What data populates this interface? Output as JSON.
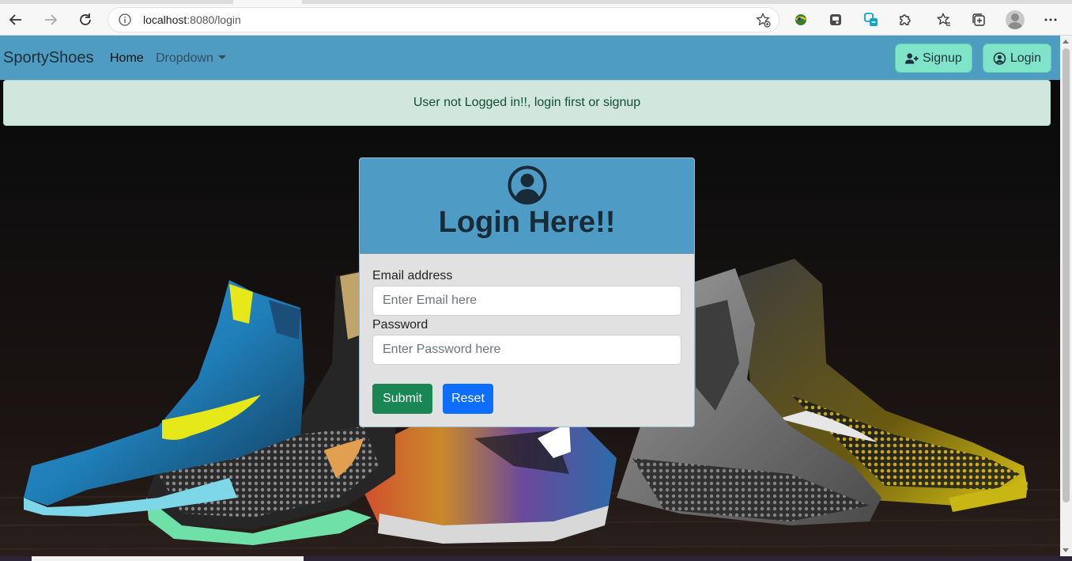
{
  "browser": {
    "url_host": "localhost",
    "url_path": ":8080/login",
    "icons": [
      "back-arrow-icon",
      "forward-arrow-icon",
      "reload-icon",
      "info-icon",
      "add-favorite-icon",
      "extension-icon",
      "extension-icon",
      "extension-icon",
      "puzzle-icon",
      "favorites-icon",
      "collections-icon",
      "profile-avatar",
      "more-icon"
    ]
  },
  "navbar": {
    "brand": "SportyShoes",
    "home": "Home",
    "dropdown": "Dropdown",
    "signup": "Signup",
    "login": "Login",
    "color": "#4f9cc3",
    "button_color": "#80e5c8"
  },
  "alert": {
    "message": "User not Logged in!!, login first or signup",
    "color": "#d1e7dd"
  },
  "card": {
    "title": "Login Here!!",
    "email_label": "Email address",
    "email_placeholder": "Enter Email here",
    "password_label": "Password",
    "password_placeholder": "Enter Password here",
    "submit": "Submit",
    "reset": "Reset",
    "header_color": "#4e9cc6",
    "submit_color": "#198754",
    "reset_color": "#0d6efd"
  }
}
